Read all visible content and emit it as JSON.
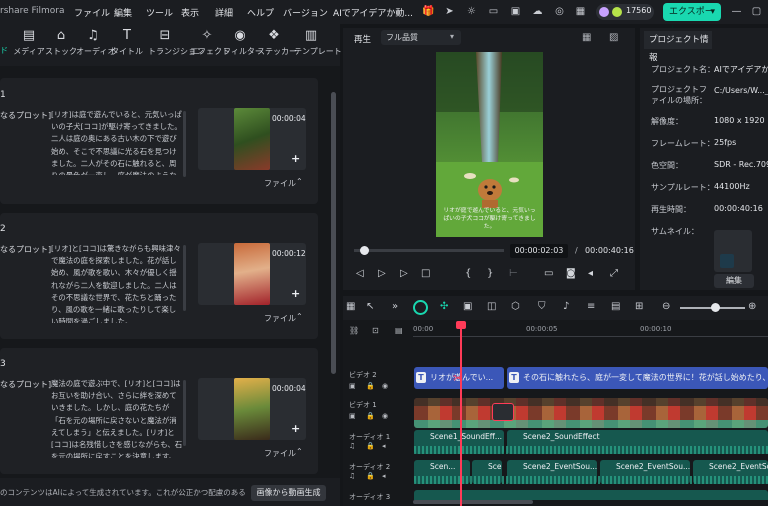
{
  "app": {
    "title": "rshare Filmora",
    "credits": "17560",
    "export_label": "エクスポート"
  },
  "menu": [
    "ファイル",
    "編集",
    "ツール",
    "表示",
    "詳細",
    "ヘルプ",
    "バージョン",
    "AIでアイデアか動..."
  ],
  "tools": [
    {
      "label": "メディア",
      "icon": "media-icon"
    },
    {
      "label": "ストック",
      "icon": "stock-icon"
    },
    {
      "label": "オーディオ",
      "icon": "audio-icon"
    },
    {
      "label": "タイトル",
      "icon": "title-icon"
    },
    {
      "label": "トランジション",
      "icon": "transition-icon"
    },
    {
      "label": "エフェクト",
      "icon": "effect-icon"
    },
    {
      "label": "フィルター",
      "icon": "filter-icon"
    },
    {
      "label": "ステッカー",
      "icon": "sticker-icon"
    },
    {
      "label": "テンプレート",
      "icon": "template-icon"
    }
  ],
  "tab_prefix": "ド",
  "scenes": [
    {
      "num": "1",
      "plot": "なるプロット]",
      "desc": "[リオ]は庭で遊んでいると、元気いっぱいの子犬[ココ]が駆け寄ってきました。二人は庭の奥にある古い木の下で遊び始め、そこで不思議に光る石を見つけました。二人がその石に触れると、周りの景色が一変し、庭が魔法のような世界に変わりました。",
      "duration": "00:00:04",
      "file": "ファイル"
    },
    {
      "num": "2",
      "plot": "なるプロット]",
      "desc": "[リオ]と[ココ]は驚きながらも興味津々で魔法の庭を探索しました。花が話し始め、風が歌を歌い、木々が優しく揺れながら二人を歓迎しました。二人はその不思議な世界で、花たちと踊ったり、風の歌を一緒に歌ったりして楽しい時間を過ごしました。",
      "duration": "00:00:12",
      "file": "ファイル"
    },
    {
      "num": "3",
      "plot": "なるプロット]",
      "desc": "魔法の庭で遊ぶ中で、[リオ]と[ココ]はお互いを助け合い、さらに絆を深めていきました。しかし、庭の花たちが「石を元の場所に戻さないと魔法が消えてしまう」と伝えました。[リオ]と[ココ]は名残惜しさを感じながらも、石を元の場所に戻すことを決意します。",
      "duration": "00:00:04",
      "file": "ファイル"
    }
  ],
  "footer": {
    "note": "のコンテンツはAIによって生成されています。これが公正かつ配慮のある方...",
    "generate_button": "画像から動画生成"
  },
  "player": {
    "tab": "再生",
    "quality": "フル品質",
    "current_time": "00:00:02:03",
    "separator": "/",
    "total_time": "00:00:40:16",
    "subtitle": "リオが庭で遊んでいると、元気いっぱいの子犬ココが駆け寄ってきました。"
  },
  "info": {
    "tab": "プロジェクト情報",
    "rows": [
      {
        "key": "プロジェクト名：",
        "value": "AIでアイデアか..."
      },
      {
        "key": "プロジェクトファイルの場所：",
        "value": "C:/Users/W..._4"
      },
      {
        "key": "解像度：",
        "value": "1080 x 1920"
      },
      {
        "key": "フレームレート：",
        "value": "25fps"
      },
      {
        "key": "色空間：",
        "value": "SDR - Rec.709"
      },
      {
        "key": "サンプルレート：",
        "value": "44100Hz"
      },
      {
        "key": "再生時間：",
        "value": "00:00:40:16"
      },
      {
        "key": "サムネイル：",
        "value": ""
      }
    ],
    "edit_button": "編集"
  },
  "timeline": {
    "ticks": [
      "00:00",
      "00:00:05",
      "00:00:10"
    ],
    "tracks": [
      {
        "label": "ビデオ 2"
      },
      {
        "label": "ビデオ 1"
      },
      {
        "label": "オーディオ 1"
      },
      {
        "label": "オーディオ 2"
      },
      {
        "label": "オーディオ 3"
      }
    ],
    "title_clips": [
      "リオが遊んでい...",
      "その石に触れたら、庭が一変して魔法の世界に！花が話し始めたり、風が歌を"
    ],
    "audio1_clips": [
      "Scene1_SoundEff...",
      "Scene2_SoundEffect"
    ],
    "audio2_clips": [
      "Scen...",
      "Scene...",
      "Scene2_EventSou...",
      "Scene2_EventSou...",
      "Scene2_EventSou..."
    ]
  },
  "colors": {
    "accent": "#19d8b0",
    "playhead": "#ff3b58",
    "title_clip": "#3b57b8",
    "audio_clip": "#16584f"
  }
}
